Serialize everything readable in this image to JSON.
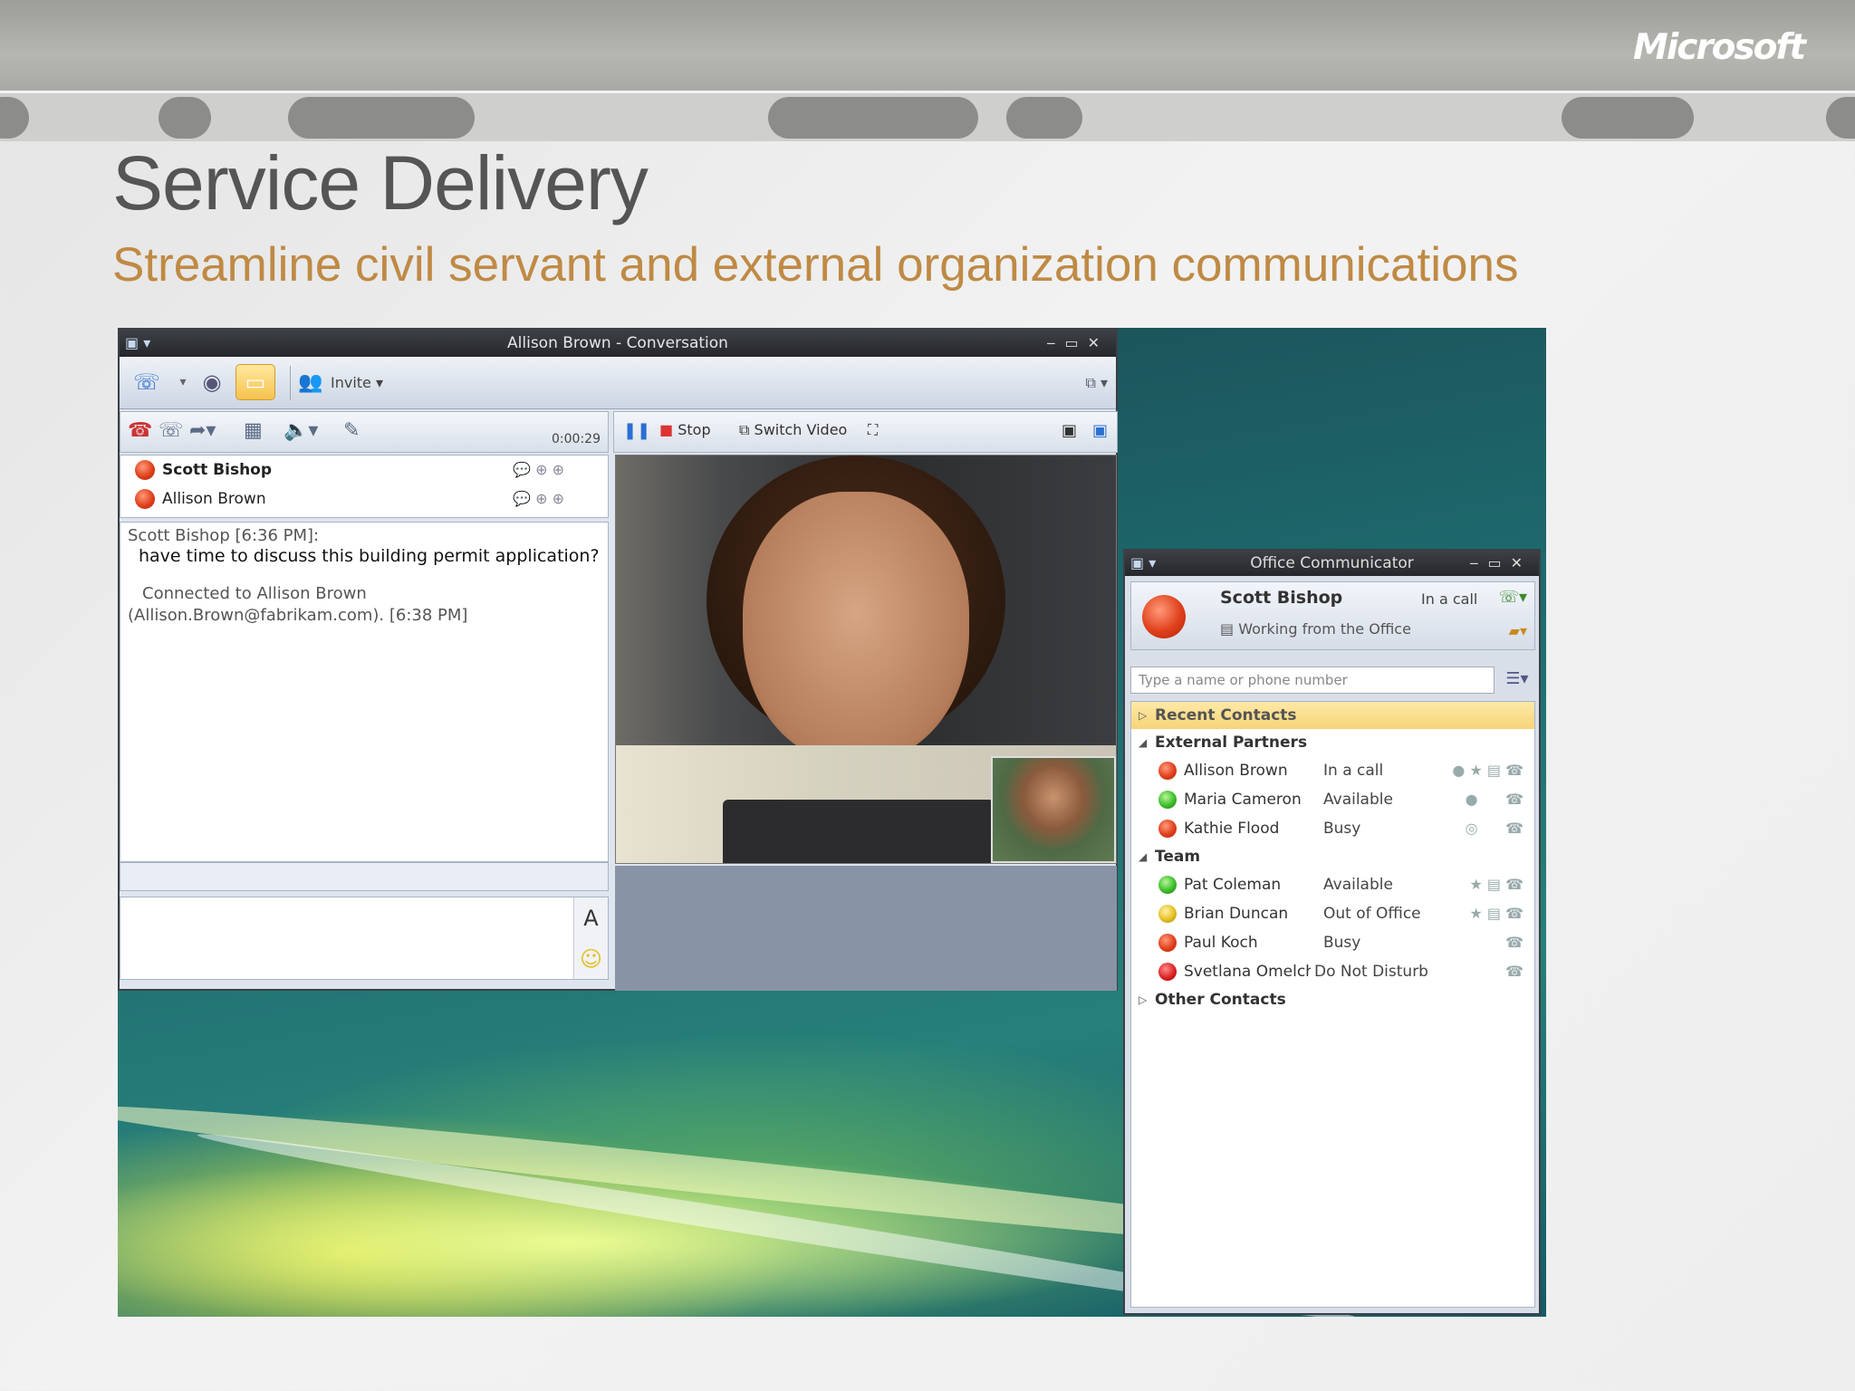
{
  "brand": {
    "logo": "Microsoft"
  },
  "slide": {
    "title": "Service Delivery",
    "subtitle": "Streamline civil servant and external organization communications"
  },
  "conversation": {
    "title": "Allison Brown - Conversation",
    "invite_label": "Invite",
    "timer": "0:00:29",
    "participants": [
      {
        "name": "Scott Bishop",
        "presence": "busy"
      },
      {
        "name": "Allison Brown",
        "presence": "busy"
      }
    ],
    "history": {
      "sender_line": "Scott Bishop [6:36 PM]:",
      "message": "have time to discuss this building permit application?",
      "system_line1": "Connected to Allison Brown",
      "system_line2": "(Allison.Brown@fabrikam.com). [6:38 PM]"
    },
    "video_controls": {
      "stop": "Stop",
      "switch_video": "Switch Video"
    },
    "format_icon": "A"
  },
  "communicator": {
    "title": "Office Communicator",
    "me": {
      "name": "Scott Bishop",
      "status": "In a call",
      "note": "Working from the Office"
    },
    "search_placeholder": "Type a name or phone number",
    "groups": [
      {
        "name": "Recent Contacts",
        "expanded": false,
        "contacts": []
      },
      {
        "name": "External Partners",
        "expanded": true,
        "contacts": [
          {
            "name": "Allison Brown",
            "status": "In a call",
            "presence": "red"
          },
          {
            "name": "Maria Cameron",
            "status": "Available",
            "presence": "green"
          },
          {
            "name": "Kathie Flood",
            "status": "Busy",
            "presence": "red"
          }
        ]
      },
      {
        "name": "Team",
        "expanded": true,
        "contacts": [
          {
            "name": "Pat Coleman",
            "status": "Available",
            "presence": "green"
          },
          {
            "name": "Brian Duncan",
            "status": "Out of Office",
            "presence": "yellow"
          },
          {
            "name": "Paul Koch",
            "status": "Busy",
            "presence": "red"
          },
          {
            "name": "Svetlana Omelch...",
            "status": "Do Not Disturb",
            "presence": "dnd"
          }
        ]
      },
      {
        "name": "Other Contacts",
        "expanded": false,
        "contacts": []
      }
    ]
  },
  "colors": {
    "subtitle": "#bf8a45",
    "title": "#555555",
    "busy": "#e0401c",
    "available": "#3cbd2a",
    "away": "#e5bf25"
  }
}
